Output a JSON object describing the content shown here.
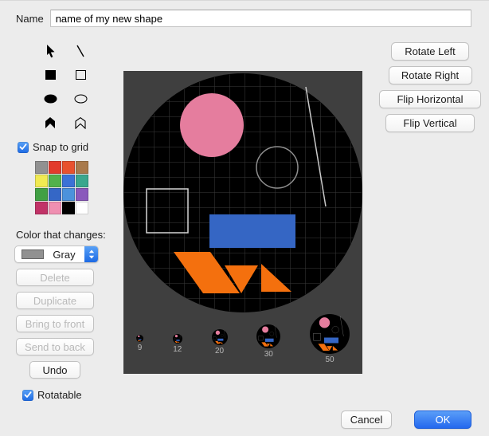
{
  "dialog": {
    "name_label": "Name",
    "name_value": "name of my new shape"
  },
  "tools": [
    {
      "id": "select",
      "icon": "cursor-icon"
    },
    {
      "id": "line",
      "icon": "line-icon"
    },
    {
      "id": "filled-rectangle",
      "icon": "filled-square-icon"
    },
    {
      "id": "outlined-rectangle",
      "icon": "outline-square-icon"
    },
    {
      "id": "filled-ellipse",
      "icon": "filled-ellipse-icon"
    },
    {
      "id": "outlined-ellipse",
      "icon": "outline-ellipse-icon"
    },
    {
      "id": "filled-polygon",
      "icon": "filled-polygon-icon"
    },
    {
      "id": "outlined-polygon",
      "icon": "outline-polygon-icon"
    }
  ],
  "snap_to_grid": {
    "label": "Snap to grid",
    "checked": true
  },
  "rotatable": {
    "label": "Rotatable",
    "checked": true
  },
  "palette": [
    "#919191",
    "#e23b2c",
    "#e8512e",
    "#a97a4c",
    "#f1ea52",
    "#52b24c",
    "#3b72d6",
    "#3aa78d",
    "#41a044",
    "#3567c6",
    "#4b92dc",
    "#8a58bc",
    "#c13367",
    "#ef8fb1",
    "#000000",
    "#ffffff"
  ],
  "color_that_changes": {
    "label": "Color that changes:",
    "value": "Gray",
    "swatch_color": "#919191"
  },
  "edit_buttons": [
    {
      "label": "Delete",
      "enabled": false
    },
    {
      "label": "Duplicate",
      "enabled": false
    },
    {
      "label": "Bring to front",
      "enabled": false
    },
    {
      "label": "Send to back",
      "enabled": false
    },
    {
      "label": "Undo",
      "enabled": true
    }
  ],
  "transform_buttons": [
    {
      "label": "Rotate Left"
    },
    {
      "label": "Rotate Right"
    },
    {
      "label": "Flip Horizontal"
    },
    {
      "label": "Flip Vertical"
    }
  ],
  "size_previews": [
    {
      "size": 9,
      "label": "9"
    },
    {
      "size": 12,
      "label": "12"
    },
    {
      "size": 20,
      "label": "20"
    },
    {
      "size": 30,
      "label": "30"
    },
    {
      "size": 50,
      "label": "50"
    }
  ],
  "footer": {
    "cancel_label": "Cancel",
    "ok_label": "OK"
  },
  "colors": {
    "window_bg": "#ececec",
    "canvas_bg": "#3f3f3f",
    "shape_area_bg": "#000000",
    "grid_line": "#3b3b3b",
    "accent_blue": "#2f7cf6",
    "shape_pink": "#e57d9e",
    "shape_blue": "#3566c4",
    "shape_orange": "#f4700e",
    "thumb_label_gray": "#b7b7b7"
  }
}
